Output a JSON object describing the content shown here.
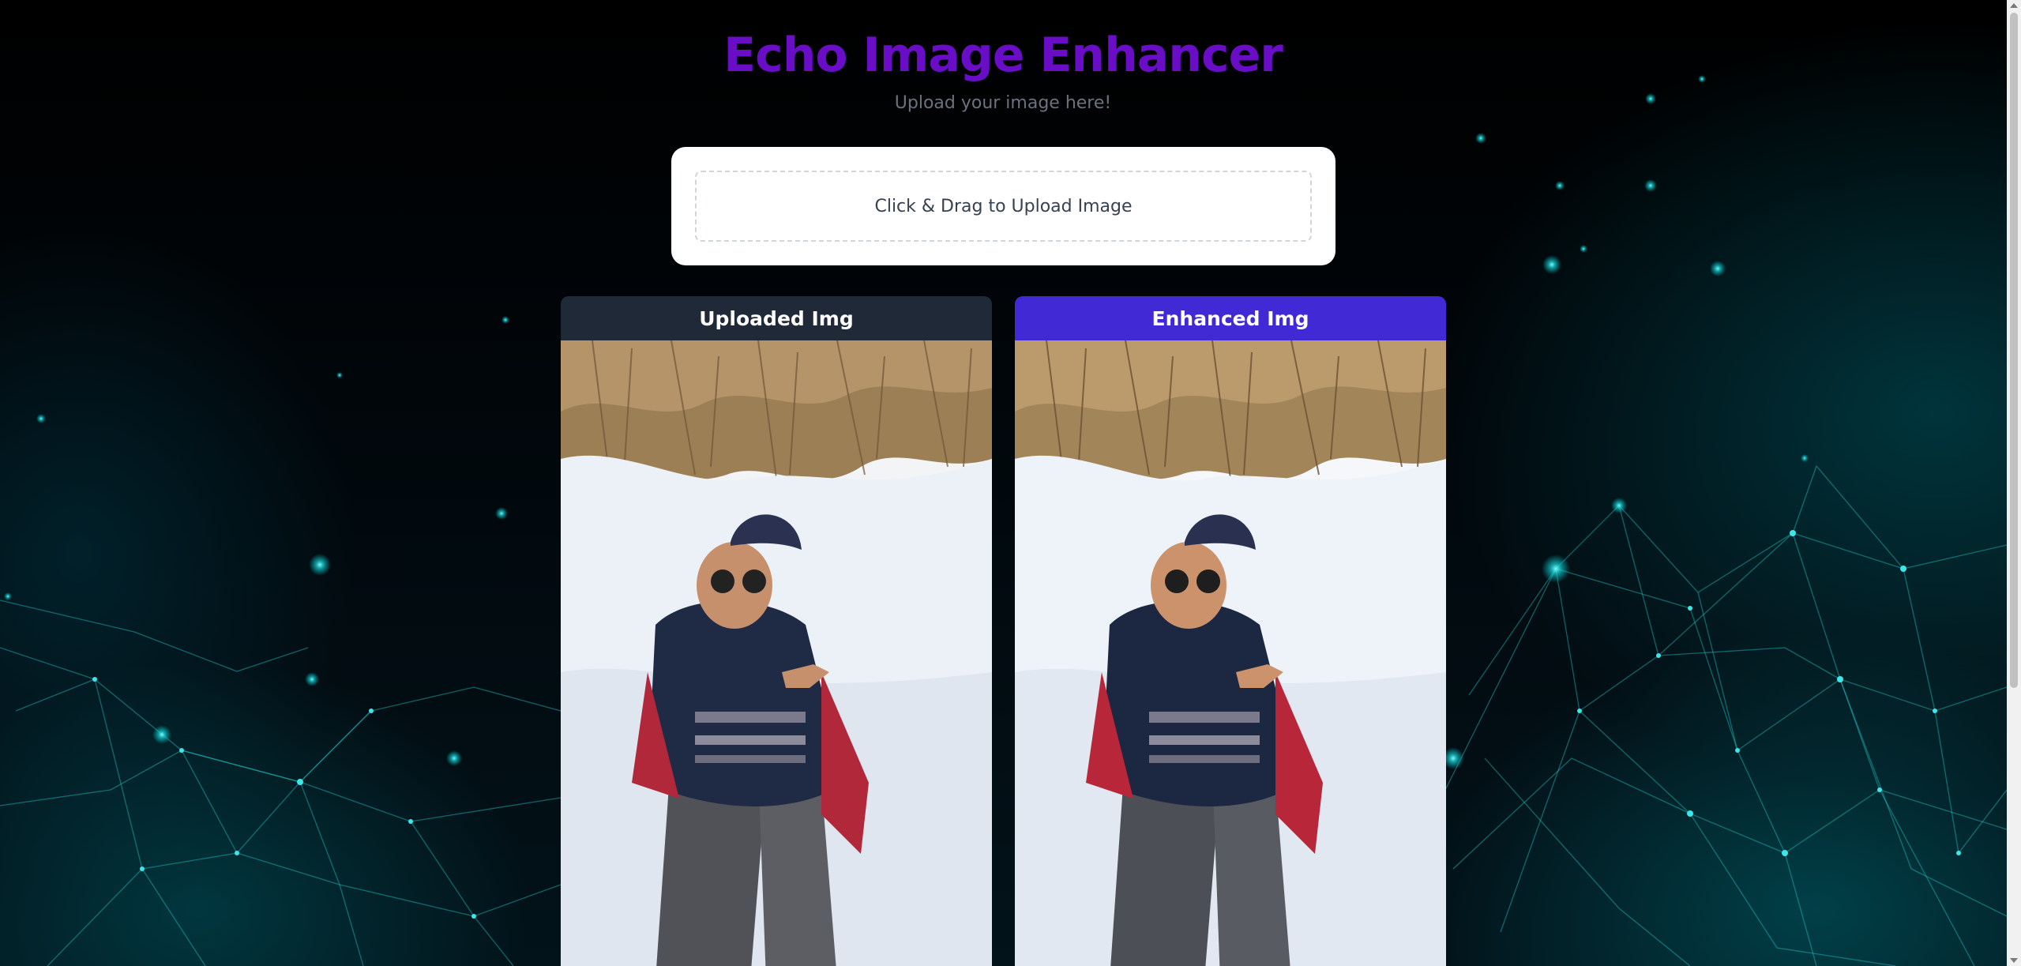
{
  "header": {
    "title": "Echo Image Enhancer",
    "subtitle": "Upload your image here!"
  },
  "upload": {
    "label": "Click & Drag to Upload Image"
  },
  "panels": {
    "uploaded": {
      "label": "Uploaded Img"
    },
    "enhanced": {
      "label": "Enhanced Img"
    }
  },
  "colors": {
    "title": "#6a0dc7",
    "uploaded_header": "#1f2937",
    "enhanced_header": "#4129d6",
    "background_glow": "#00d5d5"
  },
  "icons": {
    "background": "network-particles"
  }
}
